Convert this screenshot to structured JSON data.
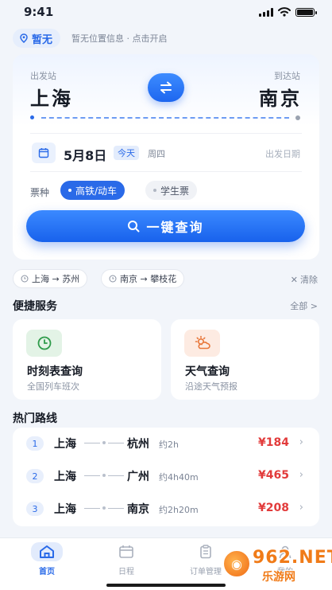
{
  "status_bar": {
    "time": "9:41"
  },
  "location": {
    "label": "暂无",
    "hint": "暂无位置信息 · 点击开启"
  },
  "search": {
    "from_label": "出发站",
    "to_label": "到达站",
    "from_city": "上海",
    "to_city": "南京",
    "date": "5月8日",
    "today_badge": "今天",
    "weekday": "周四",
    "date_label": "出发日期",
    "ticket_type_label": "票种",
    "ticket_types": [
      {
        "label": "高铁/动车",
        "selected": true
      },
      {
        "label": "学生票",
        "selected": false
      }
    ],
    "search_button": "一键查询"
  },
  "history": {
    "items": [
      "上海 → 苏州",
      "南京 → 攀枝花"
    ],
    "clear_label": "清除"
  },
  "services": {
    "title": "便捷服务",
    "more": "全部 >",
    "items": [
      {
        "title": "时刻表查询",
        "subtitle": "全国列车班次",
        "icon": "clock-icon",
        "color": "#e6f4ea"
      },
      {
        "title": "天气查询",
        "subtitle": "沿途天气预报",
        "icon": "weather-icon",
        "color": "#fdeee6"
      }
    ]
  },
  "routes": {
    "title": "热门路线",
    "items": [
      {
        "num": "1",
        "from": "上海",
        "to": "杭州",
        "duration": "约2h",
        "price": "¥184"
      },
      {
        "num": "2",
        "from": "上海",
        "to": "广州",
        "duration": "约4h40m",
        "price": "¥465"
      },
      {
        "num": "3",
        "from": "上海",
        "to": "南京",
        "duration": "约2h20m",
        "price": "¥208"
      }
    ]
  },
  "tabbar": {
    "items": [
      {
        "label": "首页",
        "icon": "home-icon",
        "active": true
      },
      {
        "label": "日程",
        "icon": "calendar-icon",
        "active": false
      },
      {
        "label": "订单管理",
        "icon": "clipboard-icon",
        "active": false
      },
      {
        "label": "我的",
        "icon": "profile-icon",
        "active": false
      }
    ]
  },
  "watermark": {
    "brand": "962.NET",
    "sub": "乐游网"
  },
  "colors": {
    "primary": "#2a6ae8",
    "price": "#e23b3b",
    "background": "#f2f5fa"
  }
}
